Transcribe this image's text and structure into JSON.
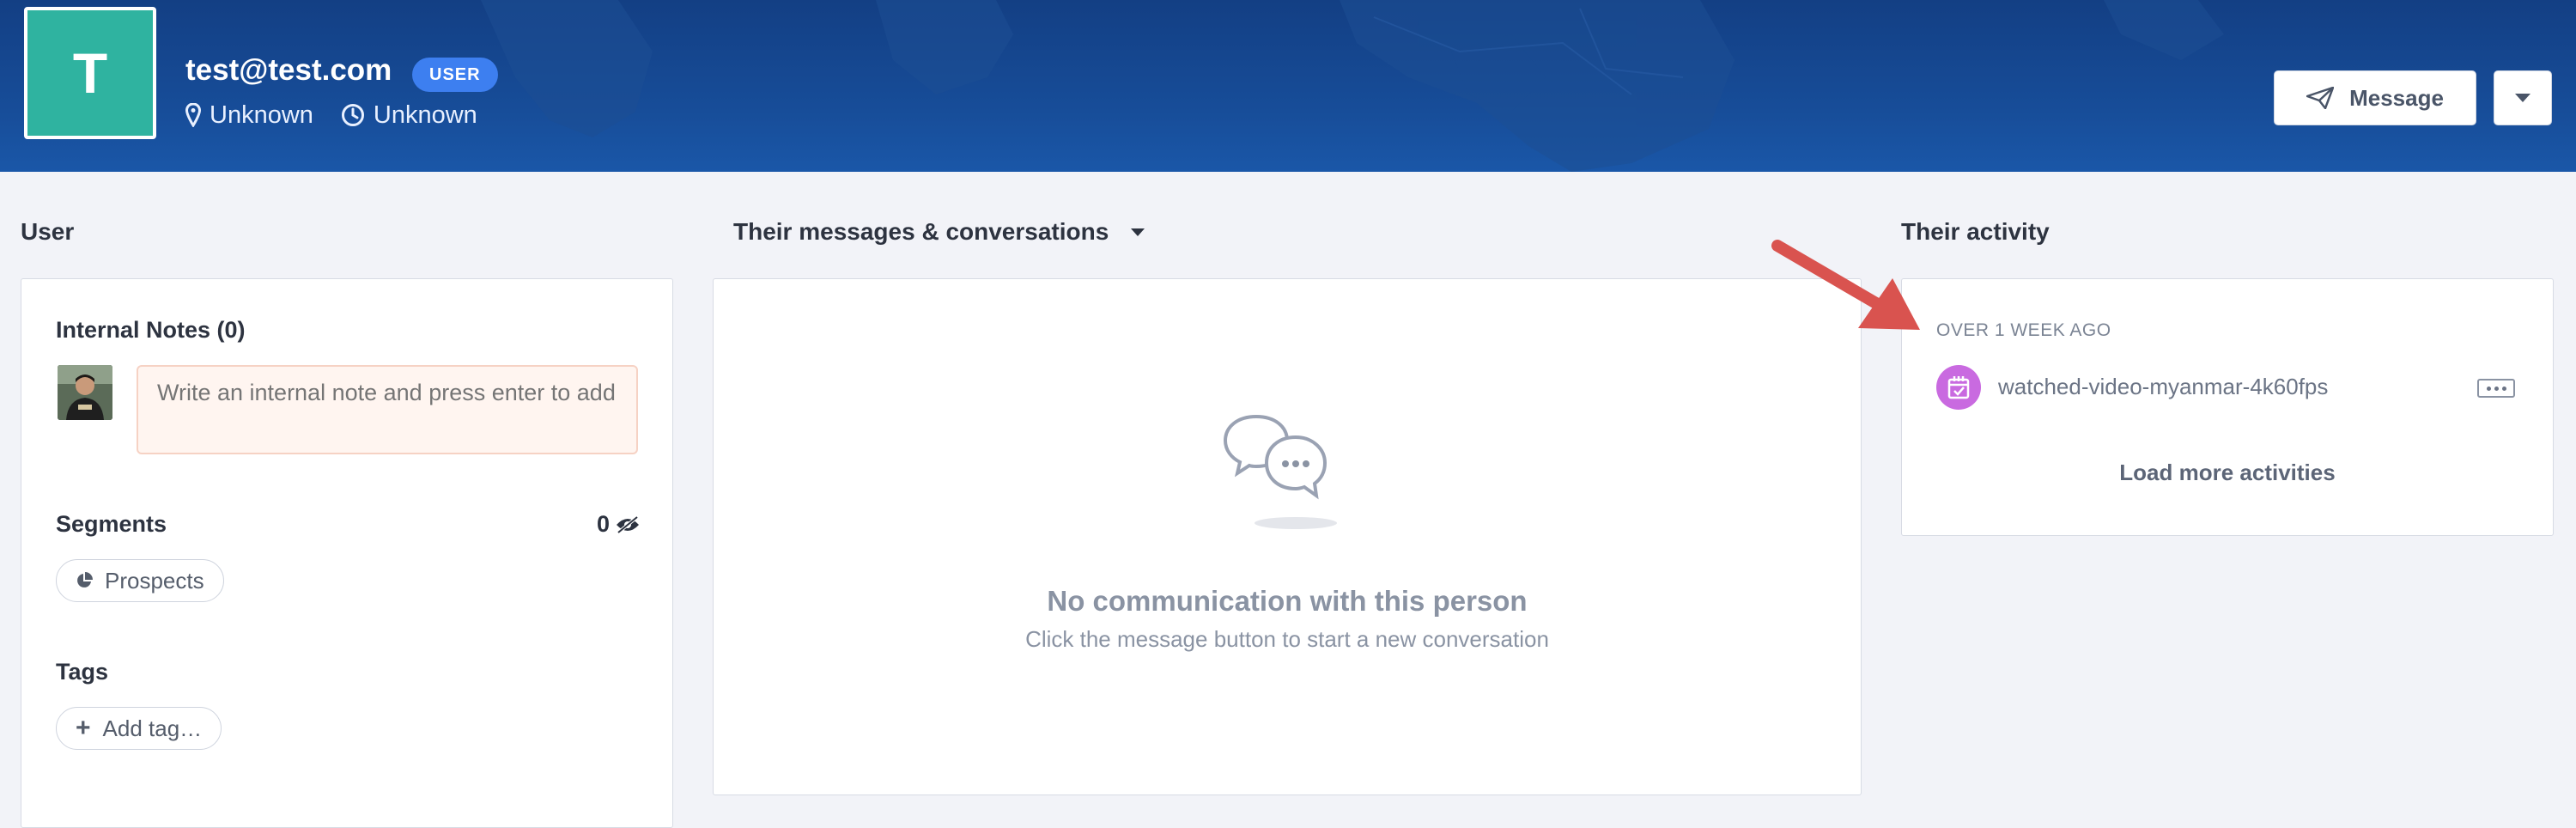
{
  "profile": {
    "avatar_initial": "T",
    "email": "test@test.com",
    "role_badge": "USER",
    "location": "Unknown",
    "local_time": "Unknown",
    "avatar_color": "#2fb3a0"
  },
  "header": {
    "message_button": "Message",
    "icons": {
      "location": "map-pin-icon",
      "time": "clock-icon",
      "message": "paper-plane-icon",
      "more": "caret-down-icon"
    }
  },
  "left_panel": {
    "title": "User",
    "notes_title": "Internal Notes (0)",
    "note_placeholder": "Write an internal note and press enter to add",
    "segments_title": "Segments",
    "segments_count": "0",
    "segments": [
      "Prospects"
    ],
    "tags_title": "Tags",
    "add_tag_label": "Add tag…"
  },
  "middle_panel": {
    "title": "Their messages & conversations",
    "empty_title": "No communication with this person",
    "empty_subtitle": "Click the message button to start a new conversation"
  },
  "right_panel": {
    "title": "Their activity",
    "time_group": "OVER 1 WEEK AGO",
    "activities": [
      {
        "label": "watched-video-myanmar-4k60fps",
        "icon": "calendar-check-icon",
        "icon_color": "#c96ae0"
      }
    ],
    "load_more": "Load more activities"
  },
  "annotation": {
    "arrow_color": "#d9534f"
  }
}
